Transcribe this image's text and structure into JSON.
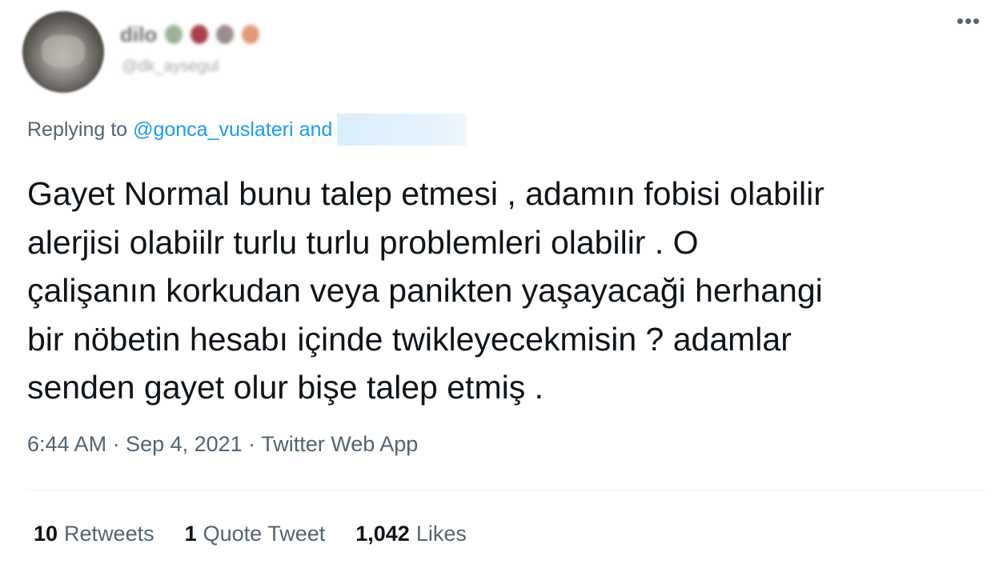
{
  "tweet": {
    "author": {
      "display_name": "dilo",
      "handle": "@dk_aysegul"
    },
    "more_icon": "more-horizontal-icon",
    "replying": {
      "prefix": "Replying to",
      "mention": "@gonca_vuslateri",
      "conjunction": "and"
    },
    "text": "Gayet Normal bunu talep etmesi , adamın fobisi olabilir\nalerjisi olabiilr turlu turlu problemleri olabilir . O\nçalişanın korkudan veya panikten yaşayacaği herhangi\nbir nöbetin hesabı içinde twikleyecekmisin ? adamlar\nsenden gayet olur bişe talep etmiş .",
    "meta": "6:44 AM · Sep 4, 2021 · Twitter Web App",
    "stats": {
      "retweets": {
        "count": "10",
        "label": "Retweets"
      },
      "quotes": {
        "count": "1",
        "label": "Quote Tweet"
      },
      "likes": {
        "count": "1,042",
        "label": "Likes"
      }
    },
    "colors": {
      "accent": "#1d9bf0",
      "secondary_text": "#536471",
      "primary_text": "#0f1419"
    }
  }
}
